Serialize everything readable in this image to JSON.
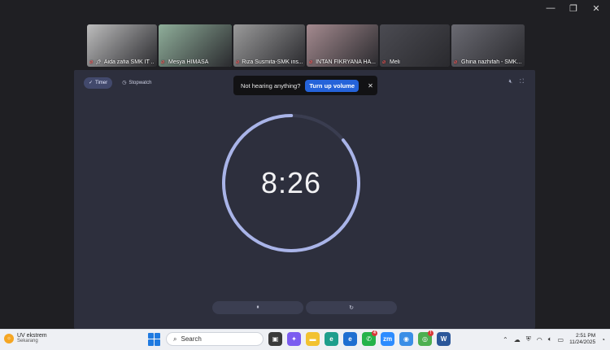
{
  "window": {
    "minimize": "—",
    "restore": "❐",
    "close": "✕"
  },
  "participants": [
    {
      "name": "Aida zafia SMK IT ...",
      "pinned": true,
      "bg": "#bdbdbd",
      "width": 86
    },
    {
      "name": "Mesya HIMASA",
      "active": true,
      "bg": "#8fae9a",
      "width": 90
    },
    {
      "name": "Riza Susmita-SMK ins...",
      "bg": "#9a9a9a",
      "width": 88
    },
    {
      "name": "INTAN FIKRYANA HA...",
      "bg": "#a48a8f",
      "width": 88
    },
    {
      "name": "Meli",
      "bg": "#4b4b52",
      "width": 86
    },
    {
      "name": "Ghina nazhifah - SMK...",
      "bg": "#6a6a72",
      "width": 90
    }
  ],
  "timer": {
    "tabs": [
      {
        "label": "Timer",
        "selected": true
      },
      {
        "label": "Stopwatch",
        "selected": false
      }
    ],
    "time": "8:26",
    "remaining_fraction": 0.86,
    "ring_color": "#a9b4e8",
    "track_color": "#3a3d50"
  },
  "toast": {
    "message": "Not hearing anything?",
    "button": "Turn up volume",
    "close": "✕"
  },
  "controls": {
    "pause": "⏸",
    "reset": "↻"
  },
  "taskbar": {
    "weather_title": "UV ekstrem",
    "weather_sub": "Sekarang",
    "search_placeholder": "Search",
    "apps": [
      {
        "name": "task-view",
        "color": "#3a3a3a",
        "glyph": "▣"
      },
      {
        "name": "copilot",
        "color": "#7b5cf0",
        "glyph": "✦"
      },
      {
        "name": "file-explorer",
        "color": "#f2c230",
        "glyph": "▬"
      },
      {
        "name": "edge",
        "color": "#1e9e8c",
        "glyph": "e"
      },
      {
        "name": "edge-blue",
        "color": "#1f6fd1",
        "glyph": "e"
      },
      {
        "name": "whatsapp",
        "color": "#25b34a",
        "glyph": "✆",
        "badge": "4"
      },
      {
        "name": "zoom",
        "color": "#2d8cff",
        "glyph": "zm"
      },
      {
        "name": "browser",
        "color": "#3a8ee6",
        "glyph": "◉"
      },
      {
        "name": "chrome",
        "color": "#4caf50",
        "glyph": "◎",
        "badge": "!"
      },
      {
        "name": "word",
        "color": "#2b579a",
        "glyph": "W"
      }
    ],
    "time": "2:51 PM",
    "date": "11/24/2025"
  }
}
